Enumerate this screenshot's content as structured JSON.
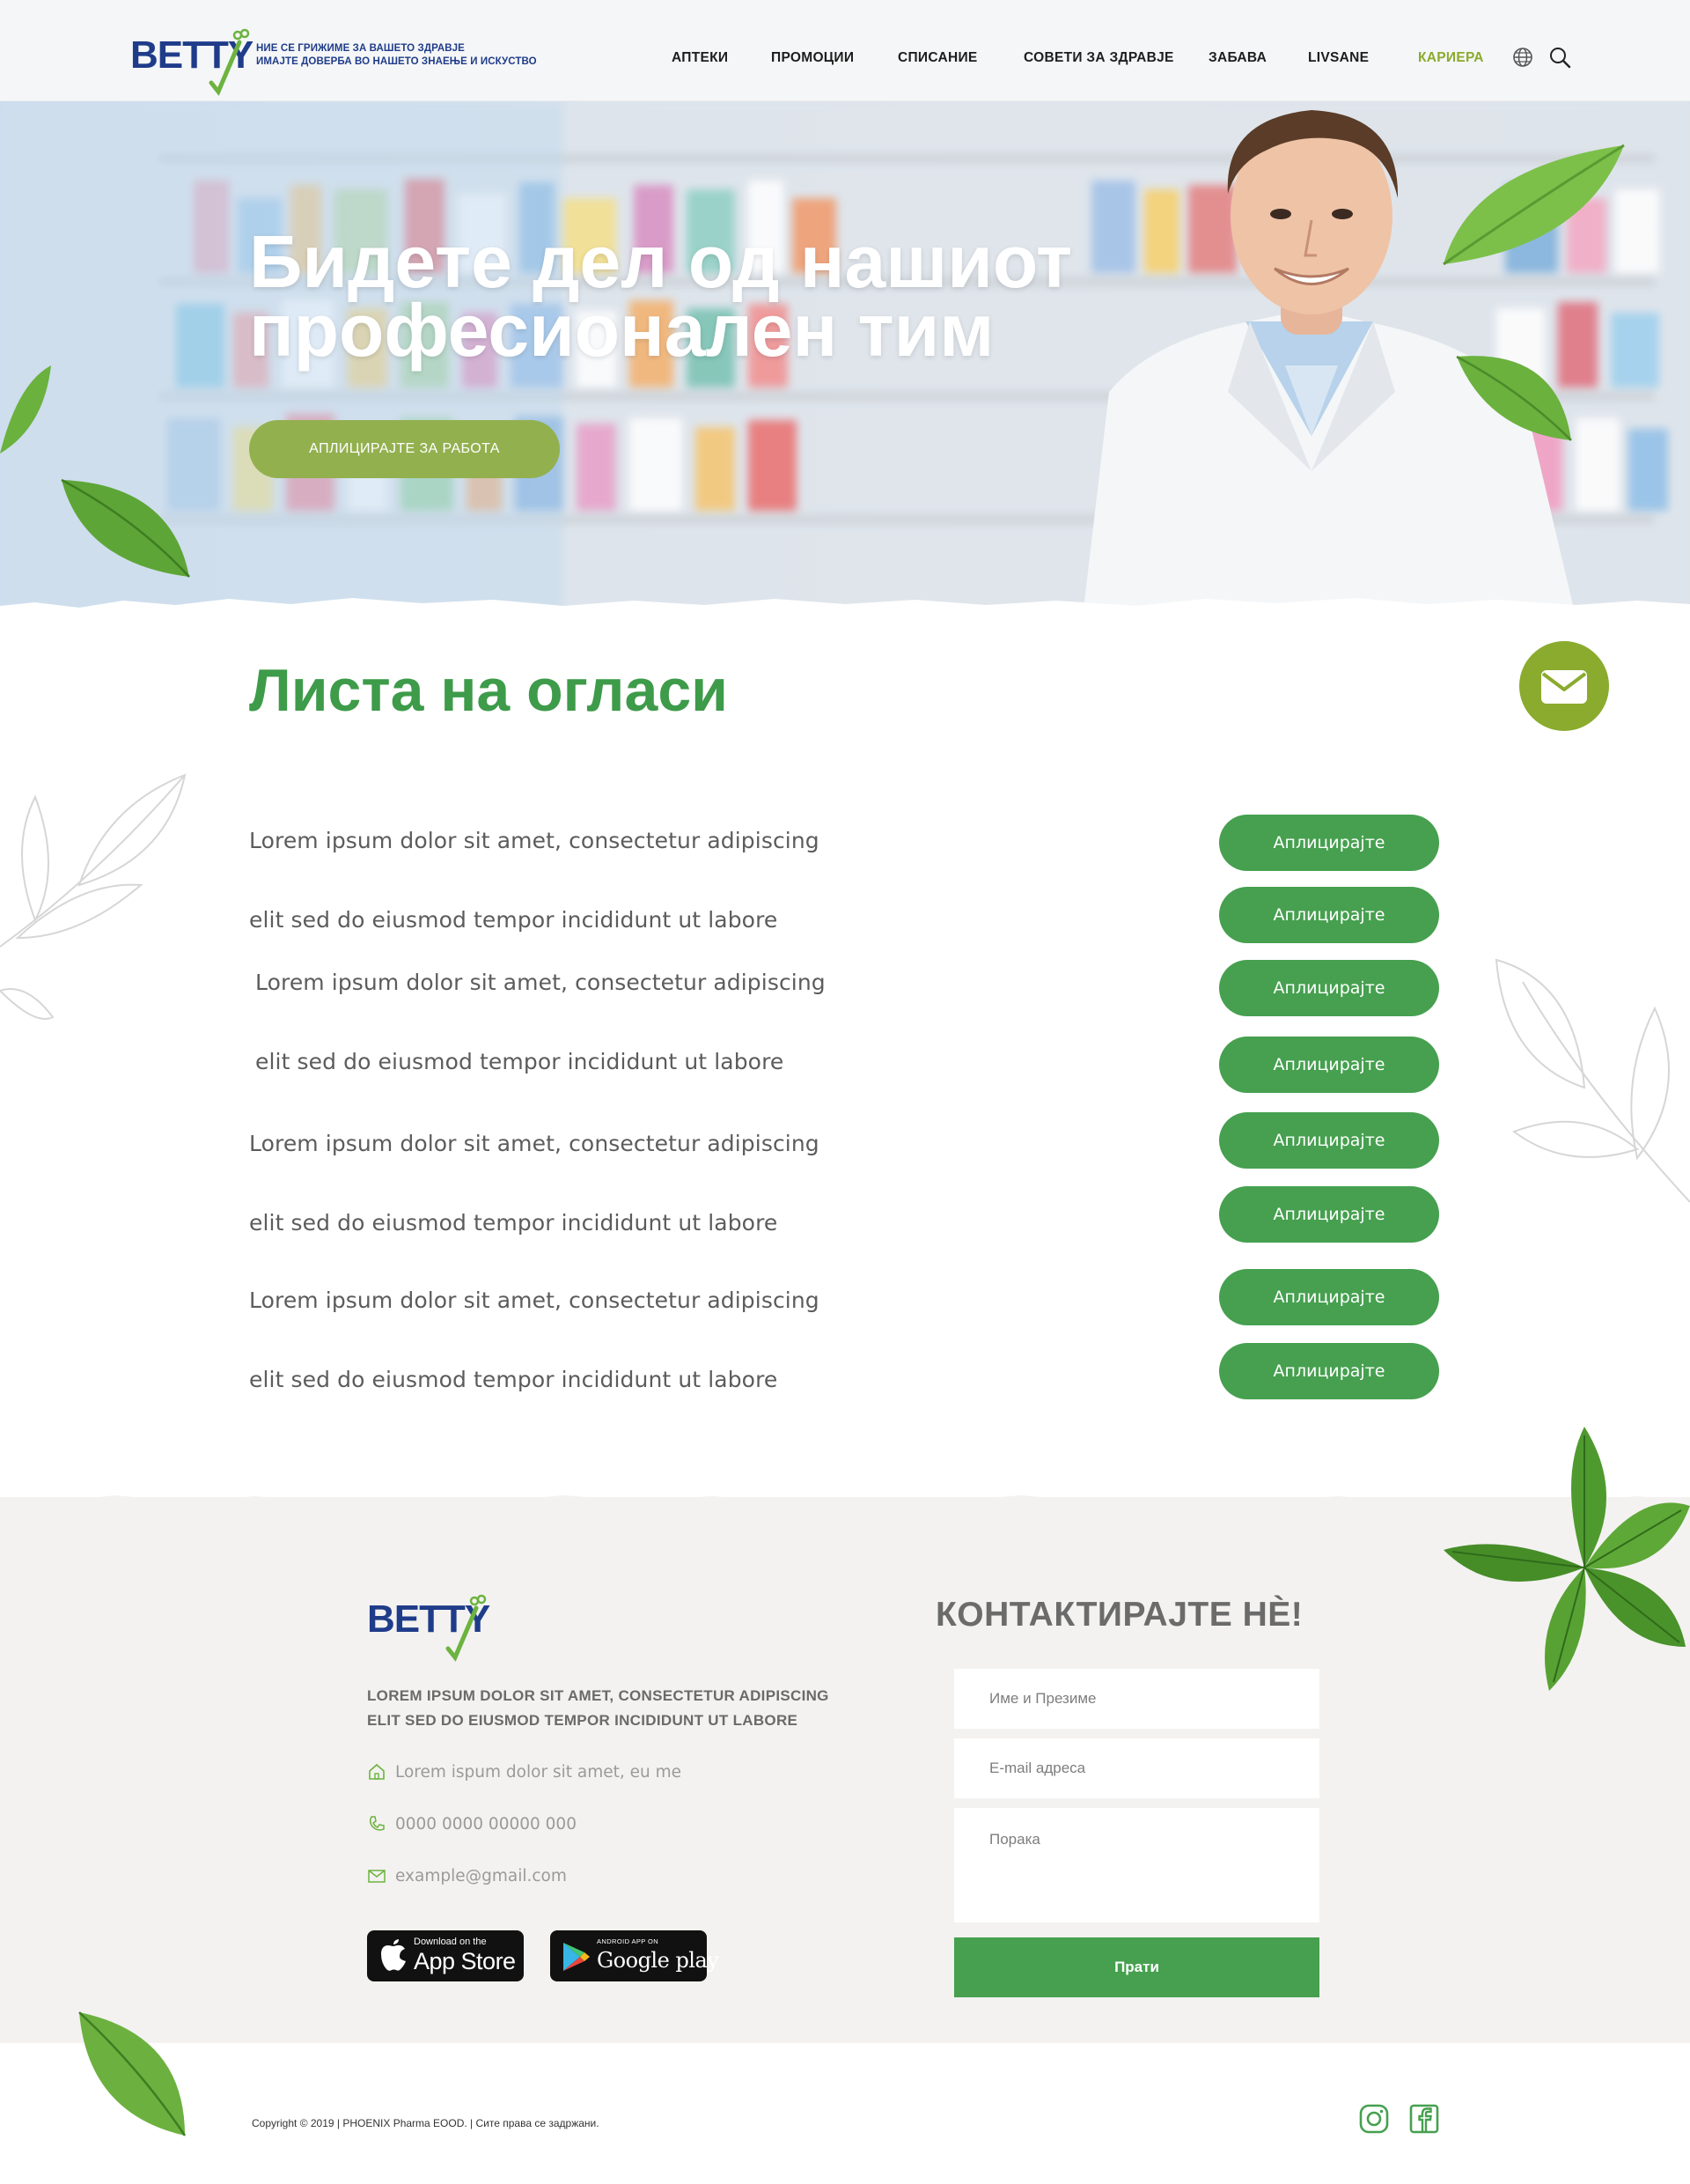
{
  "header": {
    "logo_text": "BETTY",
    "tagline_line1": "НИЕ СЕ ГРИЖИМЕ ЗА ВАШЕТО ЗДРАВЈЕ",
    "tagline_line2": "ИМАЈТЕ ДОВЕРБА ВО НАШЕТО ЗНАЕЊЕ И ИСКУСТВО",
    "nav": [
      {
        "label": "АПТЕКИ",
        "active": false
      },
      {
        "label": "ПРОМОЦИИ",
        "active": false
      },
      {
        "label": "СПИСАНИЕ",
        "active": false
      },
      {
        "label": "СОВЕТИ ЗА ЗДРАВЈЕ",
        "active": false
      },
      {
        "label": "ЗАБАВА",
        "active": false
      },
      {
        "label": "LIVSANE",
        "active": false
      },
      {
        "label": "КАРИЕРА",
        "active": true
      }
    ],
    "icons": [
      "globe-icon",
      "search-icon"
    ]
  },
  "hero": {
    "title_line1": "Бидете дел од нашиот",
    "title_line2": "професионален тим",
    "cta_label": "АПЛИЦИРАЈТЕ ЗА РАБОТА"
  },
  "jobs": {
    "title": "Листа на огласи",
    "items": [
      {
        "text": "Lorem ipsum dolor sit amet, consectetur adipiscing",
        "button": "Аплицирајте"
      },
      {
        "text": "elit sed do eiusmod tempor incididunt ut labore",
        "button": "Аплицирајте"
      },
      {
        "text": "Lorem ipsum dolor sit amet, consectetur adipiscing",
        "button": "Аплицирајте"
      },
      {
        "text": "elit sed do eiusmod tempor incididunt ut labore",
        "button": "Аплицирајте"
      },
      {
        "text": "Lorem ipsum dolor sit amet, consectetur adipiscing",
        "button": "Аплицирајте"
      },
      {
        "text": "elit sed do eiusmod tempor incididunt ut labore",
        "button": "Аплицирајте"
      },
      {
        "text": "Lorem ipsum dolor sit amet, consectetur adipiscing",
        "button": "Аплицирајте"
      },
      {
        "text": "elit sed do eiusmod tempor incididunt ut labore",
        "button": "Аплицирајте"
      }
    ]
  },
  "footer": {
    "logo_text": "BETTY",
    "description_line1": "LOREM IPSUM DOLOR SIT AMET, CONSECTETUR ADIPISCING",
    "description_line2": "ELIT SED DO EIUSMOD TEMPOR INCIDIDUNT UT LABORE",
    "address": "Lorem ispum dolor sit amet, eu me",
    "phone": "0000 0000 00000 000",
    "email": "example@gmail.com",
    "app_store_small": "Download on the",
    "app_store_big": "App Store",
    "google_play_small": "ANDROID APP ON",
    "google_play_big": "Google play",
    "contact": {
      "title": "КОНТАКТИРАЈТЕ НÈ!",
      "name_placeholder": "Име и Презиме",
      "email_placeholder": "E-mail адреса",
      "message_placeholder": "Порака",
      "send_label": "Прати"
    },
    "copyright": "Copyright © 2019 | PHOENIX Pharma EOOD. | Сите права се задржани.",
    "social": [
      "instagram-icon",
      "facebook-icon"
    ]
  },
  "colors": {
    "brand_navy": "#1f3c8a",
    "brand_green": "#46a04f",
    "accent_olive": "#8aab2e",
    "hero_button": "#93b04f"
  }
}
